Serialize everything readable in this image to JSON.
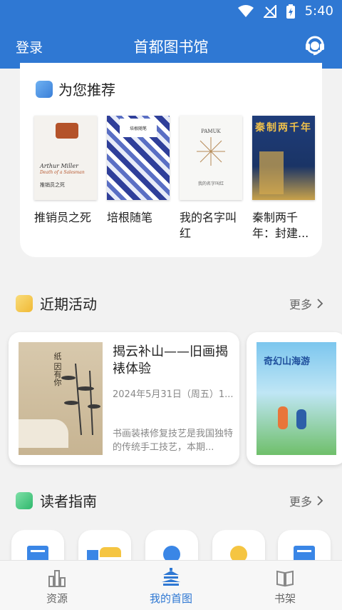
{
  "status": {
    "time": "5:40"
  },
  "header": {
    "login": "登录",
    "title": "首都图书馆"
  },
  "recommend": {
    "title": "为您推荐",
    "books": [
      {
        "name": "推销员之死",
        "cover_title": "Arthur Miller",
        "cover_sub": "Death of a Salesman",
        "cover_cn": "推销员之死"
      },
      {
        "name": "培根随笔",
        "cover_title": "培根随笔"
      },
      {
        "name": "我的名字叫红",
        "cover_title": "PAMUK",
        "cover_cn": "我的名字叫红"
      },
      {
        "name": "秦制两千年：封建...",
        "cover_title": "秦制两千年"
      }
    ]
  },
  "activities": {
    "title": "近期活动",
    "more": "更多",
    "items": [
      {
        "title": "揭云补山——旧画揭裱体验",
        "date": "2024年5月31日（周五）1...",
        "desc": "书画装裱修复技艺是我国独特的传统手工技艺，本期...",
        "poster_text": "纸 因有你"
      },
      {
        "poster_text": "奇幻山海游"
      }
    ]
  },
  "guide": {
    "title": "读者指南",
    "more": "更多"
  },
  "tabs": [
    {
      "label": "资源"
    },
    {
      "label": "我的首图"
    },
    {
      "label": "书架"
    }
  ],
  "colors": {
    "primary": "#2f78d3",
    "recommend_icon": "#4a90e2",
    "activity_icon": "#f5c542",
    "guide_icon": "#3cc47c"
  }
}
